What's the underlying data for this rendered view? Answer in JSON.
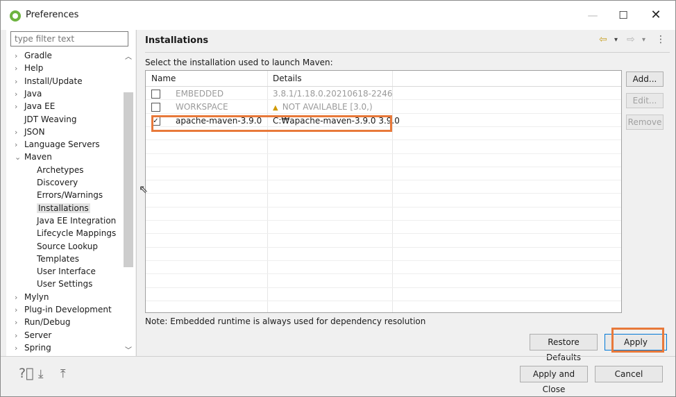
{
  "window": {
    "title": "Preferences",
    "min": "—",
    "max": "☐",
    "close": "✕"
  },
  "filter": {
    "placeholder": "type filter text"
  },
  "tree": [
    {
      "label": "Gradle",
      "chev": ">",
      "indent": 0
    },
    {
      "label": "Help",
      "chev": ">",
      "indent": 0
    },
    {
      "label": "Install/Update",
      "chev": ">",
      "indent": 0
    },
    {
      "label": "Java",
      "chev": ">",
      "indent": 0
    },
    {
      "label": "Java EE",
      "chev": ">",
      "indent": 0
    },
    {
      "label": "JDT Weaving",
      "chev": "",
      "indent": 0
    },
    {
      "label": "JSON",
      "chev": ">",
      "indent": 0
    },
    {
      "label": "Language Servers",
      "chev": ">",
      "indent": 0
    },
    {
      "label": "Maven",
      "chev": "v",
      "indent": 0
    },
    {
      "label": "Archetypes",
      "chev": "",
      "indent": 1
    },
    {
      "label": "Discovery",
      "chev": "",
      "indent": 1
    },
    {
      "label": "Errors/Warnings",
      "chev": "",
      "indent": 1
    },
    {
      "label": "Installations",
      "chev": "",
      "indent": 1,
      "selected": true
    },
    {
      "label": "Java EE Integration",
      "chev": "",
      "indent": 1
    },
    {
      "label": "Lifecycle Mappings",
      "chev": "",
      "indent": 1
    },
    {
      "label": "Source Lookup",
      "chev": "",
      "indent": 1
    },
    {
      "label": "Templates",
      "chev": "",
      "indent": 1
    },
    {
      "label": "User Interface",
      "chev": "",
      "indent": 1
    },
    {
      "label": "User Settings",
      "chev": "",
      "indent": 1
    },
    {
      "label": "Mylyn",
      "chev": ">",
      "indent": 0
    },
    {
      "label": "Plug-in Development",
      "chev": ">",
      "indent": 0
    },
    {
      "label": "Run/Debug",
      "chev": ">",
      "indent": 0
    },
    {
      "label": "Server",
      "chev": ">",
      "indent": 0
    },
    {
      "label": "Spring",
      "chev": ">",
      "indent": 0
    }
  ],
  "page": {
    "title": "Installations",
    "instruction": "Select the installation used to launch Maven:",
    "note": "Note: Embedded runtime is always used for dependency resolution",
    "nav": {
      "back": "⇦",
      "back_menu": "▾",
      "forward": "⇨",
      "forward_menu": "▾",
      "more": "⋮"
    }
  },
  "table": {
    "headers": [
      "Name",
      "Details"
    ],
    "rows": [
      {
        "checked": false,
        "name": "EMBEDDED",
        "details": "3.8.1/1.18.0.20210618-2246",
        "dim": true,
        "warn": false
      },
      {
        "checked": false,
        "name": "WORKSPACE",
        "details": "NOT AVAILABLE [3.0,)",
        "dim": true,
        "warn": true
      },
      {
        "checked": true,
        "name": "apache-maven-3.9.0",
        "details": "C:₩apache-maven-3.9.0 3.9.0",
        "dim": false,
        "warn": false
      }
    ]
  },
  "side_buttons": {
    "add": "Add...",
    "edit": "Edit...",
    "remove": "Remove"
  },
  "buttons": {
    "restore_defaults": "Restore Defaults",
    "apply": "Apply",
    "apply_close": "Apply and Close",
    "cancel": "Cancel"
  },
  "bottom_icons": [
    "help-icon",
    "import-icon",
    "export-icon"
  ],
  "colors": {
    "highlight": "#e8793a",
    "accent": "#0078d7"
  }
}
